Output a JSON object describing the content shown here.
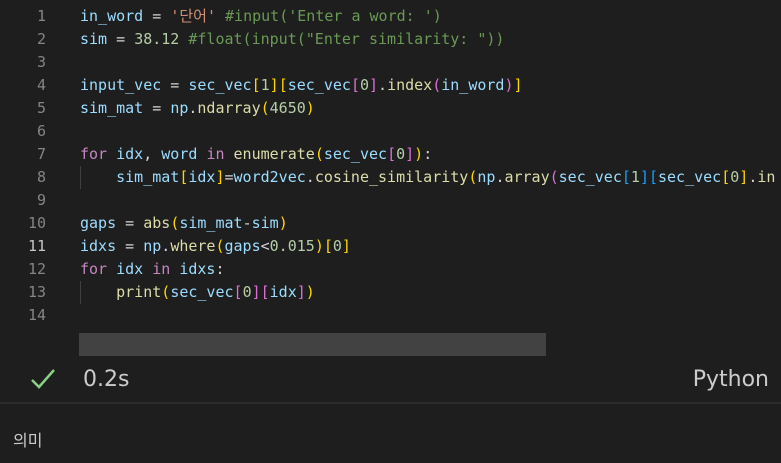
{
  "editor": {
    "line_numbers": [
      "1",
      "2",
      "3",
      "4",
      "5",
      "6",
      "7",
      "8",
      "9",
      "10",
      "11",
      "12",
      "13",
      "14"
    ],
    "lines": [
      [
        [
          "v",
          "in_word"
        ],
        [
          "o",
          " = "
        ],
        [
          "s",
          "'단어'"
        ],
        [
          "o",
          " "
        ],
        [
          "c",
          "#input('Enter a word: ')"
        ]
      ],
      [
        [
          "v",
          "sim"
        ],
        [
          "o",
          " = "
        ],
        [
          "n",
          "38.12"
        ],
        [
          "o",
          " "
        ],
        [
          "c",
          "#float(input(\"Enter similarity: \"))"
        ]
      ],
      [],
      [
        [
          "v",
          "input_vec"
        ],
        [
          "o",
          " = "
        ],
        [
          "v",
          "sec_vec"
        ],
        [
          "b1",
          "["
        ],
        [
          "n",
          "1"
        ],
        [
          "b1",
          "]"
        ],
        [
          "b1",
          "["
        ],
        [
          "v",
          "sec_vec"
        ],
        [
          "b2",
          "["
        ],
        [
          "n",
          "0"
        ],
        [
          "b2",
          "]"
        ],
        [
          "o",
          "."
        ],
        [
          "f",
          "index"
        ],
        [
          "b2",
          "("
        ],
        [
          "v",
          "in_word"
        ],
        [
          "b2",
          ")"
        ],
        [
          "b1",
          "]"
        ]
      ],
      [
        [
          "v",
          "sim_mat"
        ],
        [
          "o",
          " = "
        ],
        [
          "v",
          "np"
        ],
        [
          "o",
          "."
        ],
        [
          "f",
          "ndarray"
        ],
        [
          "b1",
          "("
        ],
        [
          "n",
          "4650"
        ],
        [
          "b1",
          ")"
        ]
      ],
      [],
      [
        [
          "k",
          "for"
        ],
        [
          "o",
          " "
        ],
        [
          "v",
          "idx"
        ],
        [
          "o",
          ", "
        ],
        [
          "v",
          "word"
        ],
        [
          "o",
          " "
        ],
        [
          "k",
          "in"
        ],
        [
          "o",
          " "
        ],
        [
          "f",
          "enumerate"
        ],
        [
          "b1",
          "("
        ],
        [
          "v",
          "sec_vec"
        ],
        [
          "b2",
          "["
        ],
        [
          "n",
          "0"
        ],
        [
          "b2",
          "]"
        ],
        [
          "b1",
          ")"
        ],
        [
          "o",
          ":"
        ]
      ],
      [
        [
          "o",
          "    "
        ],
        [
          "v",
          "sim_mat"
        ],
        [
          "b1",
          "["
        ],
        [
          "v",
          "idx"
        ],
        [
          "b1",
          "]"
        ],
        [
          "o",
          "="
        ],
        [
          "v",
          "word2vec"
        ],
        [
          "o",
          "."
        ],
        [
          "f",
          "cosine_similarity"
        ],
        [
          "b1",
          "("
        ],
        [
          "v",
          "np"
        ],
        [
          "o",
          "."
        ],
        [
          "f",
          "array"
        ],
        [
          "b2",
          "("
        ],
        [
          "v",
          "sec_vec"
        ],
        [
          "b3",
          "["
        ],
        [
          "n",
          "1"
        ],
        [
          "b3",
          "]"
        ],
        [
          "b3",
          "["
        ],
        [
          "v",
          "sec_vec"
        ],
        [
          "b1",
          "["
        ],
        [
          "n",
          "0"
        ],
        [
          "b1",
          "]"
        ],
        [
          "o",
          "."
        ],
        [
          "f",
          "in"
        ]
      ],
      [],
      [
        [
          "v",
          "gaps"
        ],
        [
          "o",
          " = "
        ],
        [
          "f",
          "abs"
        ],
        [
          "b1",
          "("
        ],
        [
          "v",
          "sim_mat"
        ],
        [
          "o",
          "-"
        ],
        [
          "v",
          "sim"
        ],
        [
          "b1",
          ")"
        ]
      ],
      [
        [
          "v",
          "idxs"
        ],
        [
          "o",
          " = "
        ],
        [
          "v",
          "np"
        ],
        [
          "o",
          "."
        ],
        [
          "f",
          "where"
        ],
        [
          "b1",
          "("
        ],
        [
          "v",
          "gaps"
        ],
        [
          "o",
          "<"
        ],
        [
          "n",
          "0.015"
        ],
        [
          "b1",
          ")"
        ],
        [
          "b1",
          "["
        ],
        [
          "n",
          "0"
        ],
        [
          "b1",
          "]"
        ]
      ],
      [
        [
          "k",
          "for"
        ],
        [
          "o",
          " "
        ],
        [
          "v",
          "idx"
        ],
        [
          "o",
          " "
        ],
        [
          "k",
          "in"
        ],
        [
          "o",
          " "
        ],
        [
          "v",
          "idxs"
        ],
        [
          "o",
          ":"
        ]
      ],
      [
        [
          "o",
          "    "
        ],
        [
          "f",
          "print"
        ],
        [
          "b1",
          "("
        ],
        [
          "v",
          "sec_vec"
        ],
        [
          "b2",
          "["
        ],
        [
          "n",
          "0"
        ],
        [
          "b2",
          "]"
        ],
        [
          "b2",
          "["
        ],
        [
          "v",
          "idx"
        ],
        [
          "b2",
          "]"
        ],
        [
          "b1",
          ")"
        ]
      ],
      []
    ],
    "active_line": 11
  },
  "status": {
    "check_icon": "check-icon",
    "time": "0.2s",
    "language": "Python",
    "check_color": "#89d185"
  },
  "output": {
    "text": "의미"
  }
}
